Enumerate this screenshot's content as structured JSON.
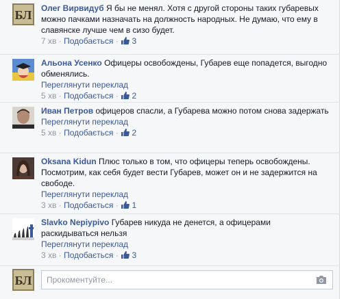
{
  "comments": [
    {
      "author": "Олег Вирвидуб",
      "text": "Я бы не менял. Хотя с другой стороны таких губаревых можно пачками назначать на должность народных. Не думаю, что ему в славянске лучше чем в сизо будет.",
      "translate": "",
      "time": "7 хв",
      "like_label": "Подобається",
      "likes": "3",
      "avatar": "logo"
    },
    {
      "author": "Альона Усенко",
      "text": "Офицеры освобождены, Губарев еще попадется, выгодно обменялись.",
      "translate": "Переглянути переклад",
      "time": "5 хв",
      "like_label": "Подобається",
      "likes": "2",
      "avatar": "graduate"
    },
    {
      "author": "Иван Петров",
      "text": "офицеров спасли, а Губарева можно потом снова задержать",
      "translate": "Переглянути переклад",
      "time": "5 хв",
      "like_label": "Подобається",
      "likes": "2",
      "avatar": "man"
    },
    {
      "author": "Oksana Kidun",
      "text": "Плюс только в том, что офицеры теперь освобождены. Посмотрим, как себя будет вести Губарев, может он и не задержится на свободе.",
      "translate": "Переглянути переклад",
      "time": "3 хв",
      "like_label": "Подобається",
      "likes": "1",
      "avatar": "woman"
    },
    {
      "author": "Slavko Nepiypivo",
      "text": "Губарев никуда не денется, а офицерами раскидываться нельзя",
      "translate": "Переглянути переклад",
      "time": "3 хв",
      "like_label": "Подобається",
      "likes": "3",
      "avatar": "evolution"
    }
  ],
  "composer": {
    "placeholder": "Прокоментуйте..."
  },
  "colors": {
    "link": "#3b5998",
    "meta": "#9197a3",
    "panel": "#f6f7f9"
  }
}
